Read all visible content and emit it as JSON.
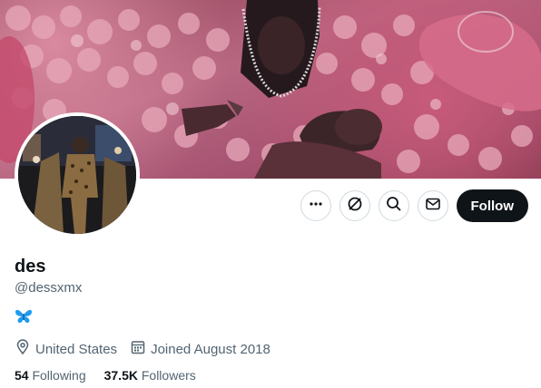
{
  "profile": {
    "name": "des",
    "handle": "@dessxmx",
    "bio_emoji": "butterfly-icon",
    "location": "United States",
    "joined": "Joined August 2018",
    "following_count": "54",
    "following_label": "Following",
    "followers_count": "37.5K",
    "followers_label": "Followers"
  },
  "actions": {
    "more_icon": "more-icon",
    "grok_icon": "grok-icon",
    "search_icon": "search-icon",
    "message_icon": "message-icon",
    "follow_label": "Follow"
  },
  "colors": {
    "follow_bg": "#0f1419",
    "secondary_text": "#536471",
    "butterfly": "#1d9bf0"
  }
}
